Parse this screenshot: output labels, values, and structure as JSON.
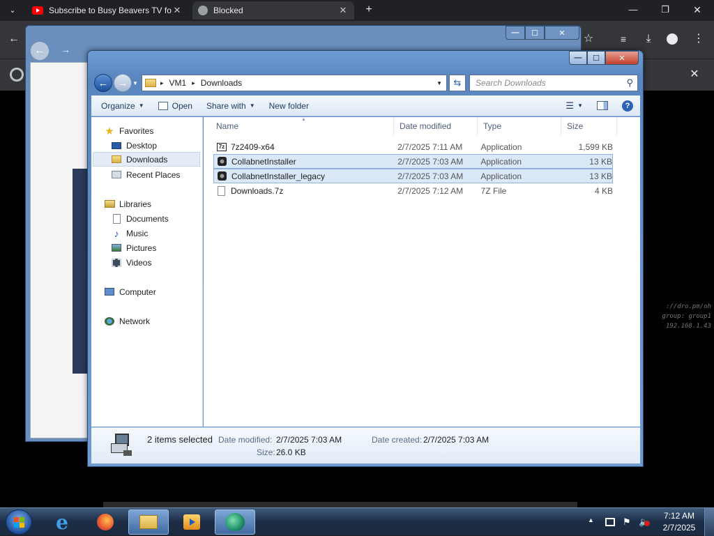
{
  "browser": {
    "tabs": [
      {
        "title": "Subscribe to Busy Beavers TV fo",
        "active": false
      },
      {
        "title": "Blocked",
        "active": true
      }
    ],
    "new_tab": "+",
    "window_controls": {
      "minimize": "—",
      "maximize": "❐",
      "close": "✕"
    }
  },
  "terminal_text": [
    "://dro.pm/oh",
    "group: group1",
    "192.168.1.43"
  ],
  "explorer": {
    "address": {
      "segments": [
        "VM1",
        "Downloads"
      ],
      "separator": "▸"
    },
    "search_placeholder": "Search Downloads",
    "commands": {
      "organize": "Organize",
      "open": "Open",
      "share": "Share with",
      "new_folder": "New folder"
    },
    "columns": {
      "name": "Name",
      "date": "Date modified",
      "type": "Type",
      "size": "Size"
    },
    "nav": {
      "favorites": "Favorites",
      "desktop": "Desktop",
      "downloads": "Downloads",
      "recent": "Recent Places",
      "libraries": "Libraries",
      "documents": "Documents",
      "music": "Music",
      "pictures": "Pictures",
      "videos": "Videos",
      "computer": "Computer",
      "network": "Network"
    },
    "files": [
      {
        "name": "7z2409-x64",
        "date": "2/7/2025 7:11 AM",
        "type": "Application",
        "size": "1,599 KB",
        "selected": false,
        "icon": "7z-icon"
      },
      {
        "name": "CollabnetInstaller",
        "date": "2/7/2025 7:03 AM",
        "type": "Application",
        "size": "13 KB",
        "selected": true,
        "icon": "installer-icon"
      },
      {
        "name": "CollabnetInstaller_legacy",
        "date": "2/7/2025 7:03 AM",
        "type": "Application",
        "size": "13 KB",
        "selected": true,
        "icon": "installer-icon"
      },
      {
        "name": "Downloads.7z",
        "date": "2/7/2025 7:12 AM",
        "type": "7Z File",
        "size": "4 KB",
        "selected": false,
        "icon": "file-icon"
      }
    ],
    "details": {
      "count": "2 items selected",
      "modified_label": "Date modified:",
      "modified_value": "2/7/2025 7:03 AM",
      "created_label": "Date created:",
      "created_value": "2/7/2025 7:03 AM",
      "size_label": "Size:",
      "size_value": "26.0 KB"
    }
  },
  "taskbar": {
    "time": "7:12 AM",
    "date": "2/7/2025",
    "tray_arrow": "▲"
  }
}
